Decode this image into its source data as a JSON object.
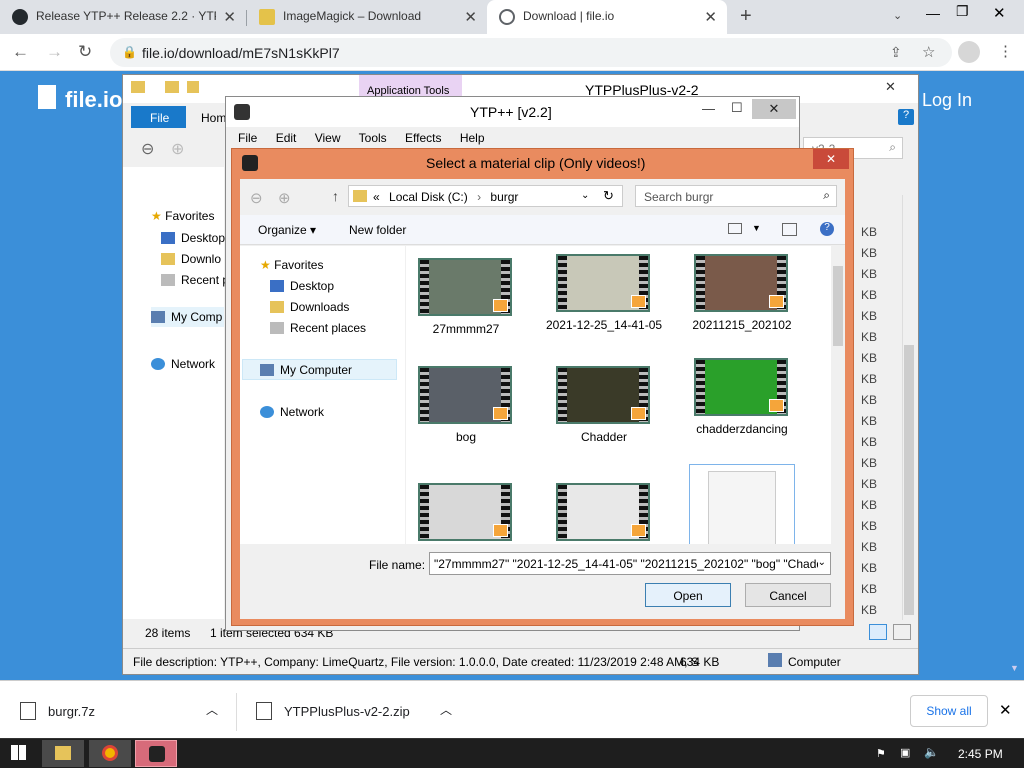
{
  "browser": {
    "tabs": [
      {
        "title": "Release YTP++ Release 2.2 · YTP...",
        "icon": "github-icon"
      },
      {
        "title": "ImageMagick – Download",
        "icon": "imagemagick-icon"
      },
      {
        "title": "Download | file.io",
        "icon": "globe-icon"
      }
    ],
    "new_tab": "+",
    "url": "file.io/download/mE7sN1sKkPl7",
    "page_logo": "file.io",
    "page_login": "Log In"
  },
  "explorer": {
    "title": "YTPPlusPlus-v2-2",
    "ribbon_context": "Application Tools",
    "file_tab": "File",
    "home_tab": "Hom",
    "search_partial": "v2-2",
    "nav": {
      "favorites": "Favorites",
      "desktop": "Desktop",
      "downloads": "Downlo",
      "recent": "Recent p",
      "computer": "My Comp",
      "network": "Network"
    },
    "sizes": [
      "KB",
      "KB",
      "KB",
      "KB",
      "KB",
      "KB",
      "KB",
      "KB",
      "KB",
      "KB",
      "KB",
      "KB",
      "KB",
      "KB",
      "KB",
      "KB",
      "KB",
      "KB",
      "KB"
    ],
    "item_count": "28 items",
    "selected": "1 item selected  634 KB",
    "status_desc": "File description: YTP++, Company: LimeQuartz, File version: 1.0.0.0, Date created: 11/23/2019 2:48 AM, S",
    "status_size": "634 KB",
    "status_location": "Computer"
  },
  "ytp": {
    "title": "YTP++ [v2.2]",
    "menu": [
      "File",
      "Edit",
      "View",
      "Tools",
      "Effects",
      "Help"
    ]
  },
  "dialog": {
    "title": "Select a material clip (Only videos!)",
    "path_prefix": "«",
    "path": [
      "Local Disk (C:)",
      "burgr"
    ],
    "search_placeholder": "Search burgr",
    "organize": "Organize ▾",
    "new_folder": "New folder",
    "nav": {
      "favorites": "Favorites",
      "desktop": "Desktop",
      "downloads": "Downloads",
      "recent": "Recent places",
      "computer": "My Computer",
      "network": "Network"
    },
    "files": [
      {
        "name": "27mmmm27",
        "color": "#6a7a6a"
      },
      {
        "name": "2021-12-25_14-41-05",
        "color": "#c8c8b8"
      },
      {
        "name": "20211215_202102",
        "color": "#7a5a4a"
      },
      {
        "name": "bog",
        "color": "#5a6068"
      },
      {
        "name": "Chadder",
        "color": "#3a3a28"
      },
      {
        "name": "chadderzdancing",
        "color": "#2aa02a"
      },
      {
        "name": "",
        "color": "#d8d8d8"
      },
      {
        "name": "",
        "color": "#e8e8e8"
      },
      {
        "name": "",
        "color": "#ffffff"
      }
    ],
    "filename_label": "File name:",
    "filename_value": "\"27mmmm27\" \"2021-12-25_14-41-05\" \"20211215_202102\" \"bog\" \"Chadd",
    "open": "Open",
    "cancel": "Cancel"
  },
  "downloads": {
    "items": [
      "burgr.7z",
      "YTPPlusPlus-v2-2.zip"
    ],
    "show_all": "Show all"
  },
  "taskbar": {
    "time": "2:45 PM"
  }
}
